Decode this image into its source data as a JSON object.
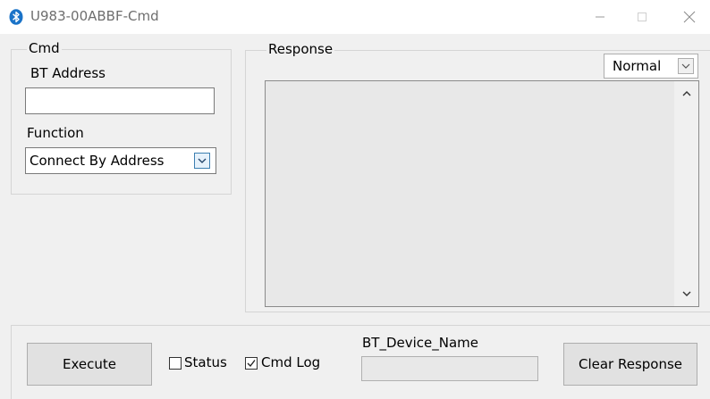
{
  "window": {
    "title": "U983-00ABBF-Cmd",
    "app_icon": "bluetooth-icon",
    "controls": [
      "minimize-icon",
      "maximize-icon",
      "close-icon"
    ]
  },
  "cmd_panel": {
    "legend": "Cmd",
    "bt_address_label": "BT Address",
    "bt_address_value": "",
    "function_label": "Function",
    "function_value": "Connect By Address"
  },
  "response_panel": {
    "legend": "Response",
    "mode_value": "Normal",
    "text": ""
  },
  "bottom_bar": {
    "execute_label": "Execute",
    "status_label": "Status",
    "status_checked": false,
    "cmd_log_label": "Cmd Log",
    "cmd_log_checked": true,
    "device_name_label": "BT_Device_Name",
    "device_name_value": "",
    "clear_label": "Clear Response"
  },
  "colors": {
    "window_bg": "#f0f0f0",
    "titlebar_bg": "#ffffff",
    "bluetooth_icon": "#1a73c8",
    "dropdown_accent": "#3c7fb1"
  }
}
